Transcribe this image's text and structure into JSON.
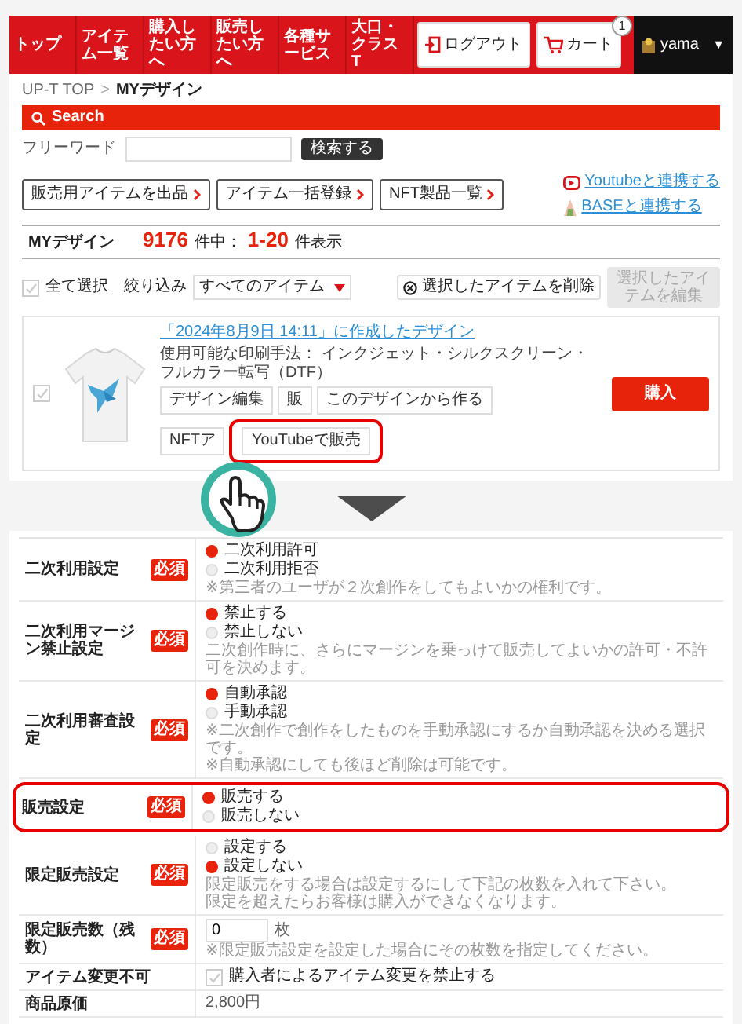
{
  "nav": {
    "items": [
      {
        "label": "トップ"
      },
      {
        "label": "アイテム一覧"
      },
      {
        "label": "購入したい方へ"
      },
      {
        "label": "販売したい方へ"
      },
      {
        "label": "各種サービス"
      },
      {
        "label": "大口・クラスT"
      }
    ],
    "logout": "ログアウト",
    "cart": {
      "label": "カート",
      "badge": "1"
    },
    "user": {
      "name": "yama",
      "caret": "▼"
    }
  },
  "breadcrumb": {
    "items": [
      "UP-T TOP",
      "MYデザイン"
    ],
    "separator": ">"
  },
  "search": {
    "title": "Search",
    "label": "フリーワード",
    "button": "検索する"
  },
  "actions": [
    "販売用アイテムを出品",
    "アイテム一括登録",
    "NFT製品一覧"
  ],
  "links": [
    {
      "label": "Youtubeと連携する",
      "kind": "youtube"
    },
    {
      "label": "BASEと連携する",
      "kind": "base"
    }
  ],
  "summary": {
    "title": "MYデザイン",
    "total": "9176",
    "total_suffix": "件中：",
    "range": "1-20",
    "range_suffix": "件表示"
  },
  "toolbar": {
    "select_all": {
      "label": "全て選択",
      "checked": false
    },
    "filter_label": "絞り込み",
    "filter_value": "すべてのアイテム",
    "delete": "選択したアイテムを削除",
    "edit": {
      "label": "選択したアイテムを編集",
      "disabled": true
    }
  },
  "item": {
    "checked": false,
    "title": "「2024年8月9日 14:11」に作成したデザイン",
    "methods": "使用可能な印刷手法： インクジェット・シルクスクリーン・フルカラー転写（DTF）",
    "buttons": [
      {
        "label": "デザイン編集",
        "highlighted": false
      },
      {
        "label": "販",
        "highlighted": false
      },
      {
        "label": "このデザインから作る",
        "highlighted": false
      },
      {
        "label": "NFTア",
        "highlighted": false
      },
      {
        "label": "YouTubeで販売",
        "highlighted": true
      }
    ],
    "buy": "購入"
  },
  "settings": [
    {
      "label": "二次利用設定",
      "badge": "必須",
      "kind": "radio",
      "highlighted": false,
      "options": [
        {
          "label": "二次利用許可",
          "selected": true
        },
        {
          "label": "二次利用拒否",
          "selected": false
        }
      ],
      "notes": [
        "※第三者のユーザが２次創作をしてもよいかの権利です。"
      ]
    },
    {
      "label": "二次利用マージン禁止設定",
      "badge": "必須",
      "kind": "radio",
      "highlighted": false,
      "options": [
        {
          "label": "禁止する",
          "selected": true
        },
        {
          "label": "禁止しない",
          "selected": false
        }
      ],
      "notes": [
        "二次創作時に、さらにマージンを乗っけて販売してよいかの許可・不許可を決めます。"
      ]
    },
    {
      "label": "二次利用審査設定",
      "badge": "必須",
      "kind": "radio",
      "highlighted": false,
      "options": [
        {
          "label": "自動承認",
          "selected": true
        },
        {
          "label": "手動承認",
          "selected": false
        }
      ],
      "notes": [
        "※二次創作で創作をしたものを手動承認にするか自動承認を決める選択です。",
        "※自動承認にしても後ほど削除は可能です。"
      ]
    },
    {
      "label": "販売設定",
      "badge": "必須",
      "kind": "radio",
      "highlighted": true,
      "options": [
        {
          "label": "販売する",
          "selected": true
        },
        {
          "label": "販売しない",
          "selected": false
        }
      ]
    },
    {
      "label": "限定販売設定",
      "badge": "必須",
      "kind": "radio",
      "highlighted": false,
      "options": [
        {
          "label": "設定する",
          "selected": false
        },
        {
          "label": "設定しない",
          "selected": true
        }
      ],
      "notes": [
        "限定販売をする場合は設定するにして下記の枚数を入れて下さい。",
        "限定を超えたらお客様は購入ができなくなります。"
      ]
    },
    {
      "label": "限定販売数（残数）",
      "badge": "必須",
      "kind": "number",
      "highlighted": false,
      "value": "0",
      "unit": "枚",
      "notes": [
        "※限定販売設定を設定した場合にその枚数を指定してください。"
      ]
    },
    {
      "label": "アイテム変更不可",
      "kind": "checkbox",
      "highlighted": false,
      "checked": false,
      "text": "購入者によるアイテム変更を禁止する"
    },
    {
      "label": "商品原価",
      "kind": "text",
      "highlighted": false,
      "text": "2,800円"
    }
  ]
}
